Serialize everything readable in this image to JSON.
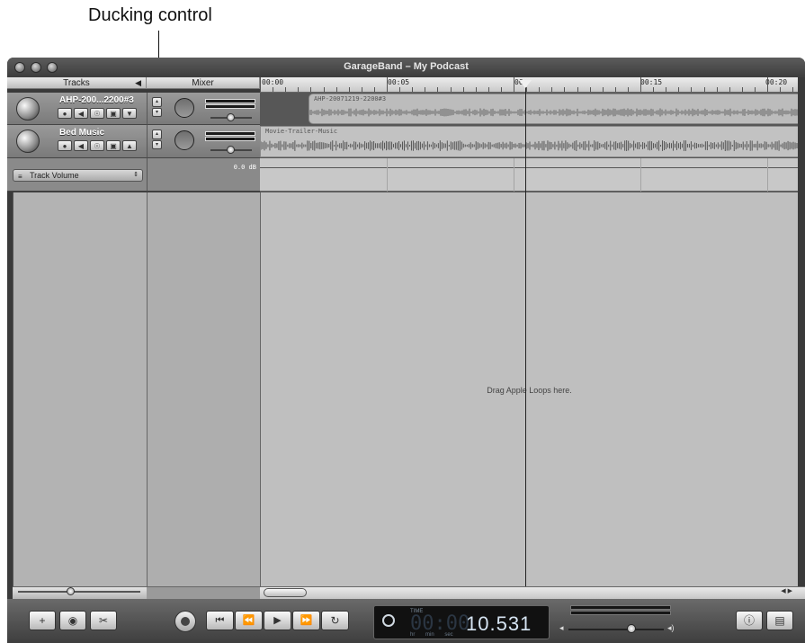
{
  "callout": {
    "text": "Ducking control"
  },
  "window": {
    "title": "GarageBand – My Podcast"
  },
  "headers": {
    "tracks": "Tracks",
    "tracks_toggle": "◀",
    "mixer": "Mixer"
  },
  "ruler": {
    "labels": [
      "00:00",
      "00:05",
      "00",
      "00:15",
      "00:20"
    ]
  },
  "tracks": [
    {
      "name": "AHP-200...2200#3",
      "region": "AHP-20071219-2200#3",
      "buttons": [
        "●",
        "◀",
        "☉",
        "▣",
        "▼"
      ],
      "ducking": [
        "▴",
        "▾"
      ]
    },
    {
      "name": "Bed Music",
      "region": "Movie-Trailer-Music",
      "buttons": [
        "●",
        "◀",
        "☉",
        "▣",
        "▲"
      ],
      "ducking": [
        "▴",
        "▾"
      ]
    }
  ],
  "automation": {
    "param": "Track Volume",
    "value": "0.0 dB"
  },
  "loops_hint": "Drag Apple Loops here.",
  "lcd": {
    "label": "TIME",
    "dim_digits": "00:00",
    "value": "10.531",
    "units": "hr min sec"
  },
  "bottom_buttons": {
    "add": "+",
    "eye": "◉",
    "scissors": "✂",
    "info": "ⓘ",
    "media": "▤"
  },
  "transport": {
    "rewind_start": "⏮",
    "rewind": "⏪",
    "play": "▶",
    "forward": "⏩",
    "loop": "↻"
  },
  "colors": {
    "window": "#3a3a3a",
    "track_strip": "#8a8a8a",
    "loops_bg": "#bfbfbf",
    "lcd_value": "#d6e4f2"
  }
}
